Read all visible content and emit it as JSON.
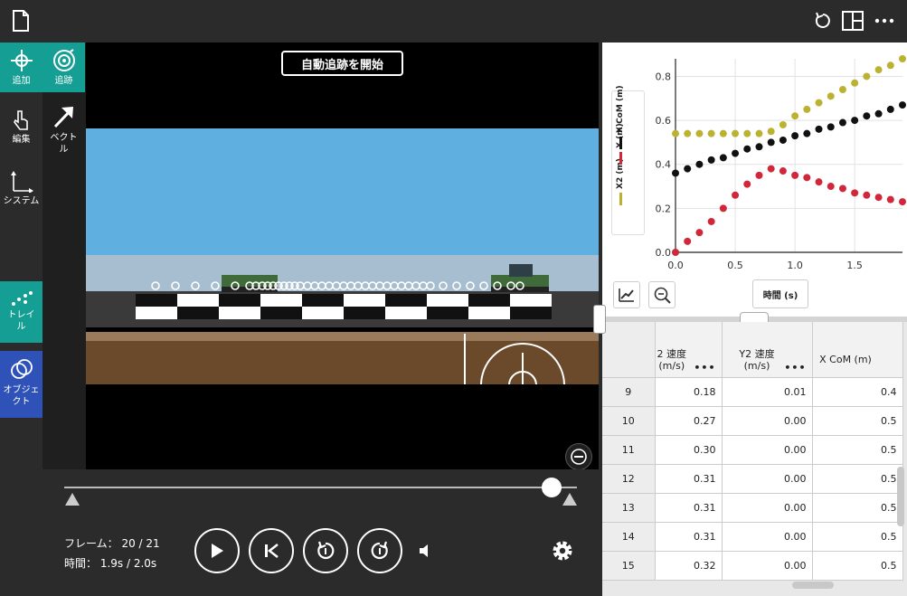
{
  "toolbar": {
    "add_label": "追加",
    "track_label": "追跡",
    "edit_label": "編集",
    "vector_label": "ベクトル",
    "system_label": "システム",
    "trail_label": "トレイル",
    "object_label": "オブジェクト"
  },
  "video": {
    "auto_track_button": "自動追跡を開始"
  },
  "playback": {
    "frame_label": "フレーム：",
    "frame_value": "20 / 21",
    "time_label": "時間：",
    "time_value": "1.9s / 2.0s",
    "scrub_progress": 0.95
  },
  "chart_data": {
    "type": "scatter",
    "xlabel": "時間 (s)",
    "ylabel": "",
    "xlim": [
      0,
      1.9
    ],
    "ylim": [
      0,
      0.88
    ],
    "xticks": [
      "0.0",
      "0.5",
      "1.0",
      "1.5"
    ],
    "yticks": [
      "0.0",
      "0.2",
      "0.4",
      "0.6",
      "0.8"
    ],
    "grid": true,
    "legend_position": "left",
    "series": [
      {
        "name": "X CoM (m)",
        "color": "#111111",
        "x": [
          0.0,
          0.1,
          0.2,
          0.3,
          0.4,
          0.5,
          0.6,
          0.7,
          0.8,
          0.9,
          1.0,
          1.1,
          1.2,
          1.3,
          1.4,
          1.5,
          1.6,
          1.7,
          1.8,
          1.9
        ],
        "y": [
          0.36,
          0.38,
          0.4,
          0.42,
          0.43,
          0.45,
          0.47,
          0.48,
          0.5,
          0.51,
          0.53,
          0.54,
          0.56,
          0.57,
          0.59,
          0.6,
          0.62,
          0.63,
          0.65,
          0.67
        ]
      },
      {
        "name": "X (m)",
        "color": "#d0283a",
        "x": [
          0.0,
          0.1,
          0.2,
          0.3,
          0.4,
          0.5,
          0.6,
          0.7,
          0.8,
          0.9,
          1.0,
          1.1,
          1.2,
          1.3,
          1.4,
          1.5,
          1.6,
          1.7,
          1.8,
          1.9
        ],
        "y": [
          0.0,
          0.05,
          0.09,
          0.14,
          0.2,
          0.26,
          0.31,
          0.35,
          0.38,
          0.37,
          0.35,
          0.34,
          0.32,
          0.3,
          0.29,
          0.27,
          0.26,
          0.25,
          0.24,
          0.23
        ]
      },
      {
        "name": "X2 (m)",
        "color": "#bcb232",
        "x": [
          0.0,
          0.1,
          0.2,
          0.3,
          0.4,
          0.5,
          0.6,
          0.7,
          0.8,
          0.9,
          1.0,
          1.1,
          1.2,
          1.3,
          1.4,
          1.5,
          1.6,
          1.7,
          1.8,
          1.9
        ],
        "y": [
          0.54,
          0.54,
          0.54,
          0.54,
          0.54,
          0.54,
          0.54,
          0.54,
          0.55,
          0.58,
          0.62,
          0.65,
          0.68,
          0.71,
          0.74,
          0.77,
          0.8,
          0.83,
          0.85,
          0.88
        ]
      }
    ]
  },
  "table": {
    "headers": [
      "",
      "2 速度\n(m/s)",
      "Y2 速度\n(m/s)",
      "X CoM (m)"
    ],
    "menu_glyph": "•••",
    "rows": [
      [
        "9",
        "0.18",
        "0.01",
        "0.4"
      ],
      [
        "10",
        "0.27",
        "0.00",
        "0.5"
      ],
      [
        "11",
        "0.30",
        "0.00",
        "0.5"
      ],
      [
        "12",
        "0.31",
        "0.00",
        "0.5"
      ],
      [
        "13",
        "0.31",
        "0.00",
        "0.5"
      ],
      [
        "14",
        "0.31",
        "0.00",
        "0.5"
      ],
      [
        "15",
        "0.32",
        "0.00",
        "0.5"
      ]
    ]
  },
  "icons": [
    "document-icon",
    "undo-icon",
    "layout-icon",
    "more-icon",
    "play-icon",
    "skip-start-icon",
    "step-back-icon",
    "step-forward-icon",
    "volume-icon",
    "settings-icon",
    "zoom-out-icon"
  ]
}
